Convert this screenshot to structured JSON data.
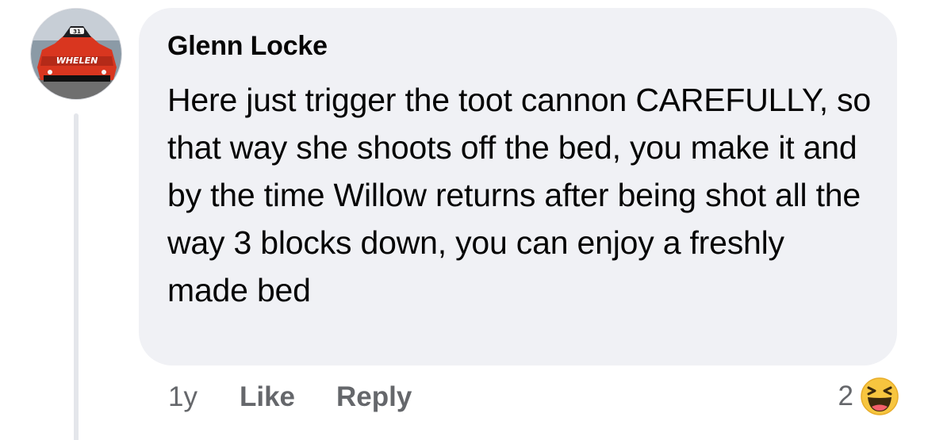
{
  "comment": {
    "author": "Glenn Locke",
    "avatar_icon": "race-car-avatar-icon",
    "text": "Here just trigger the toot cannon CAREFULLY, so that way she shoots off the bed, you make it and by the time Willow returns after being shot all the way 3 blocks down, you can enjoy a freshly made bed",
    "time": "1y",
    "like_label": "Like",
    "reply_label": "Reply",
    "reaction_count": "2",
    "reaction_icon": "haha-laughing-emoji-icon"
  },
  "avatar_logo_text": "WHELEN",
  "avatar_number_text": "31",
  "colors": {
    "bubble": "#f0f1f5",
    "text": "#050505",
    "secondary_text": "#65676b",
    "thread_line": "#e4e6eb",
    "car_red": "#d9361f",
    "emoji_yellow": "#f7c53f"
  }
}
